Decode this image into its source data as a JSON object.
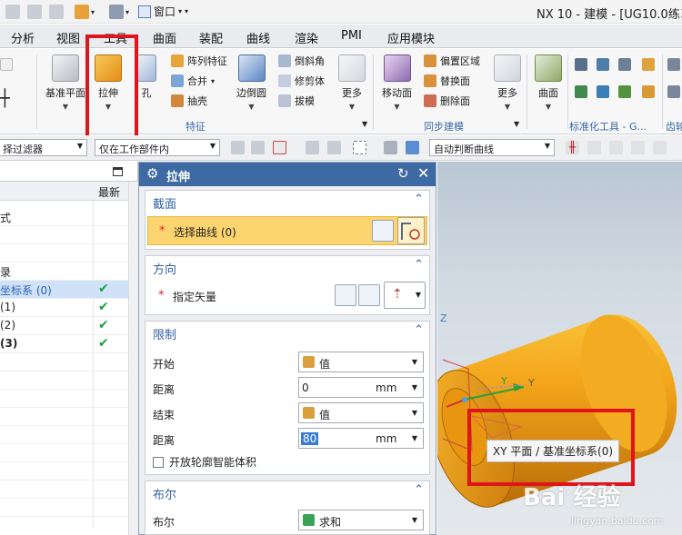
{
  "titlebar": {
    "window_menu": "窗口",
    "app_title": "NX 10 - 建模 - [UG10.0练习"
  },
  "menu_tabs": [
    "分析",
    "视图",
    "工具",
    "曲面",
    "装配",
    "曲线",
    "渲染",
    "PMI",
    "应用模块"
  ],
  "ribbon": {
    "datum_plane": "基准平面",
    "extrude": "拉伸",
    "hole": "孔",
    "pattern_feature": "阵列特征",
    "unite": "合并",
    "shell": "抽壳",
    "edge_blend": "边倒圆",
    "chamfer": "倒斜角",
    "trim_body": "修剪体",
    "draft": "拔模",
    "more": "更多",
    "feature_group": "特征",
    "move_face": "移动面",
    "offset_region": "偏置区域",
    "replace_face": "替换面",
    "delete_face": "删除面",
    "sync_group": "同步建模",
    "more2": "更多",
    "surface": "曲面",
    "standard_tools_group": "标准化工具 - G...",
    "gear_group": "齿轮"
  },
  "selection_bar": {
    "filter": "择过滤器",
    "scope": "仅在工作部件内",
    "curve_rule": "自动判断曲线"
  },
  "navigator": {
    "column_latest": "最新",
    "rows": [
      {
        "text": "式",
        "check": false
      },
      {
        "text": "",
        "check": false
      },
      {
        "text": "",
        "check": false
      },
      {
        "text": "录",
        "check": false
      },
      {
        "text": "坐标系 (0)",
        "check": true
      },
      {
        "text": " (1)",
        "check": true
      },
      {
        "text": " (2)",
        "check": true
      },
      {
        "text": " (3)",
        "check": true
      }
    ]
  },
  "dialog": {
    "title": "拉伸",
    "section": {
      "title": "截面",
      "select_curve": "选择曲线 (0)"
    },
    "direction": {
      "title": "方向",
      "specify_vector": "指定矢量"
    },
    "limits": {
      "title": "限制",
      "start_label": "开始",
      "start_value": "值",
      "distance1_label": "距离",
      "distance1_value": "0",
      "distance1_unit": "mm",
      "end_label": "结束",
      "end_value": "值",
      "distance2_label": "距离",
      "distance2_value": "80",
      "distance2_unit": "mm",
      "open_profile": "开放轮廓智能体积"
    },
    "boolean": {
      "title": "布尔",
      "boolean_label": "布尔",
      "boolean_value": "求和"
    }
  },
  "viewport": {
    "axis_z": "Z",
    "axis_y": "Y",
    "axis_y2": "Y",
    "tooltip": "XY 平面 / 基准坐标系(0)"
  },
  "watermark": {
    "text": "Bai 经验",
    "url": "jingyan.baidu.com"
  },
  "colors": {
    "ribbon_group_label": "#3a6aa8",
    "dialog_title_bg": "#3e6aa3",
    "active_row_bg": "#fcd570",
    "highlight_red": "#e0141b",
    "cylinder_orange": "#f2a81c",
    "check_green": "#19a23b"
  }
}
